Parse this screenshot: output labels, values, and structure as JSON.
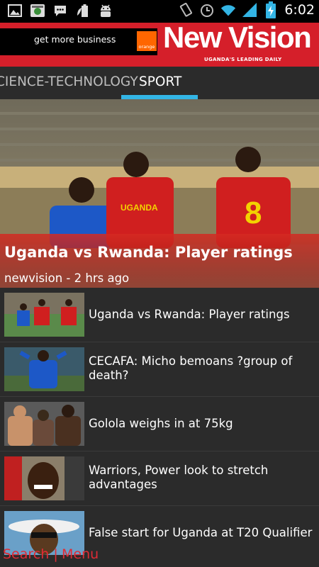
{
  "status_bar": {
    "left_icons": [
      "gallery-icon",
      "media-icon",
      "chat-icon",
      "battery-saver-icon",
      "android-icon"
    ],
    "right_icons": [
      "vibrate-icon",
      "alarm-icon",
      "wifi-icon",
      "signal-icon",
      "battery-charging-icon"
    ],
    "time": "6:02"
  },
  "header": {
    "ad_text": "get more business",
    "ad_logo": "orange",
    "brand_name": "New Vision",
    "brand_tagline": "UGANDA'S LEADING DAILY",
    "brand_color": "#d51f2a"
  },
  "tabs": {
    "previous": "CIENCE-TECHNOLOGY",
    "active": "SPORT",
    "accent_color": "#33b5e5"
  },
  "hero": {
    "title": "Uganda vs Rwanda: Player ratings",
    "meta": "newvision - 2 hrs ago"
  },
  "articles": [
    {
      "title": "Uganda vs Rwanda: Player ratings"
    },
    {
      "title": "CECAFA: Micho bemoans ?group of death?"
    },
    {
      "title": "Golola weighs in at 75kg"
    },
    {
      "title": "Warriors, Power look to stretch advantages"
    },
    {
      "title": "False start for Uganda at T20 Qualifier"
    }
  ],
  "footer": {
    "search": "Search |",
    "menu": "Menu"
  }
}
